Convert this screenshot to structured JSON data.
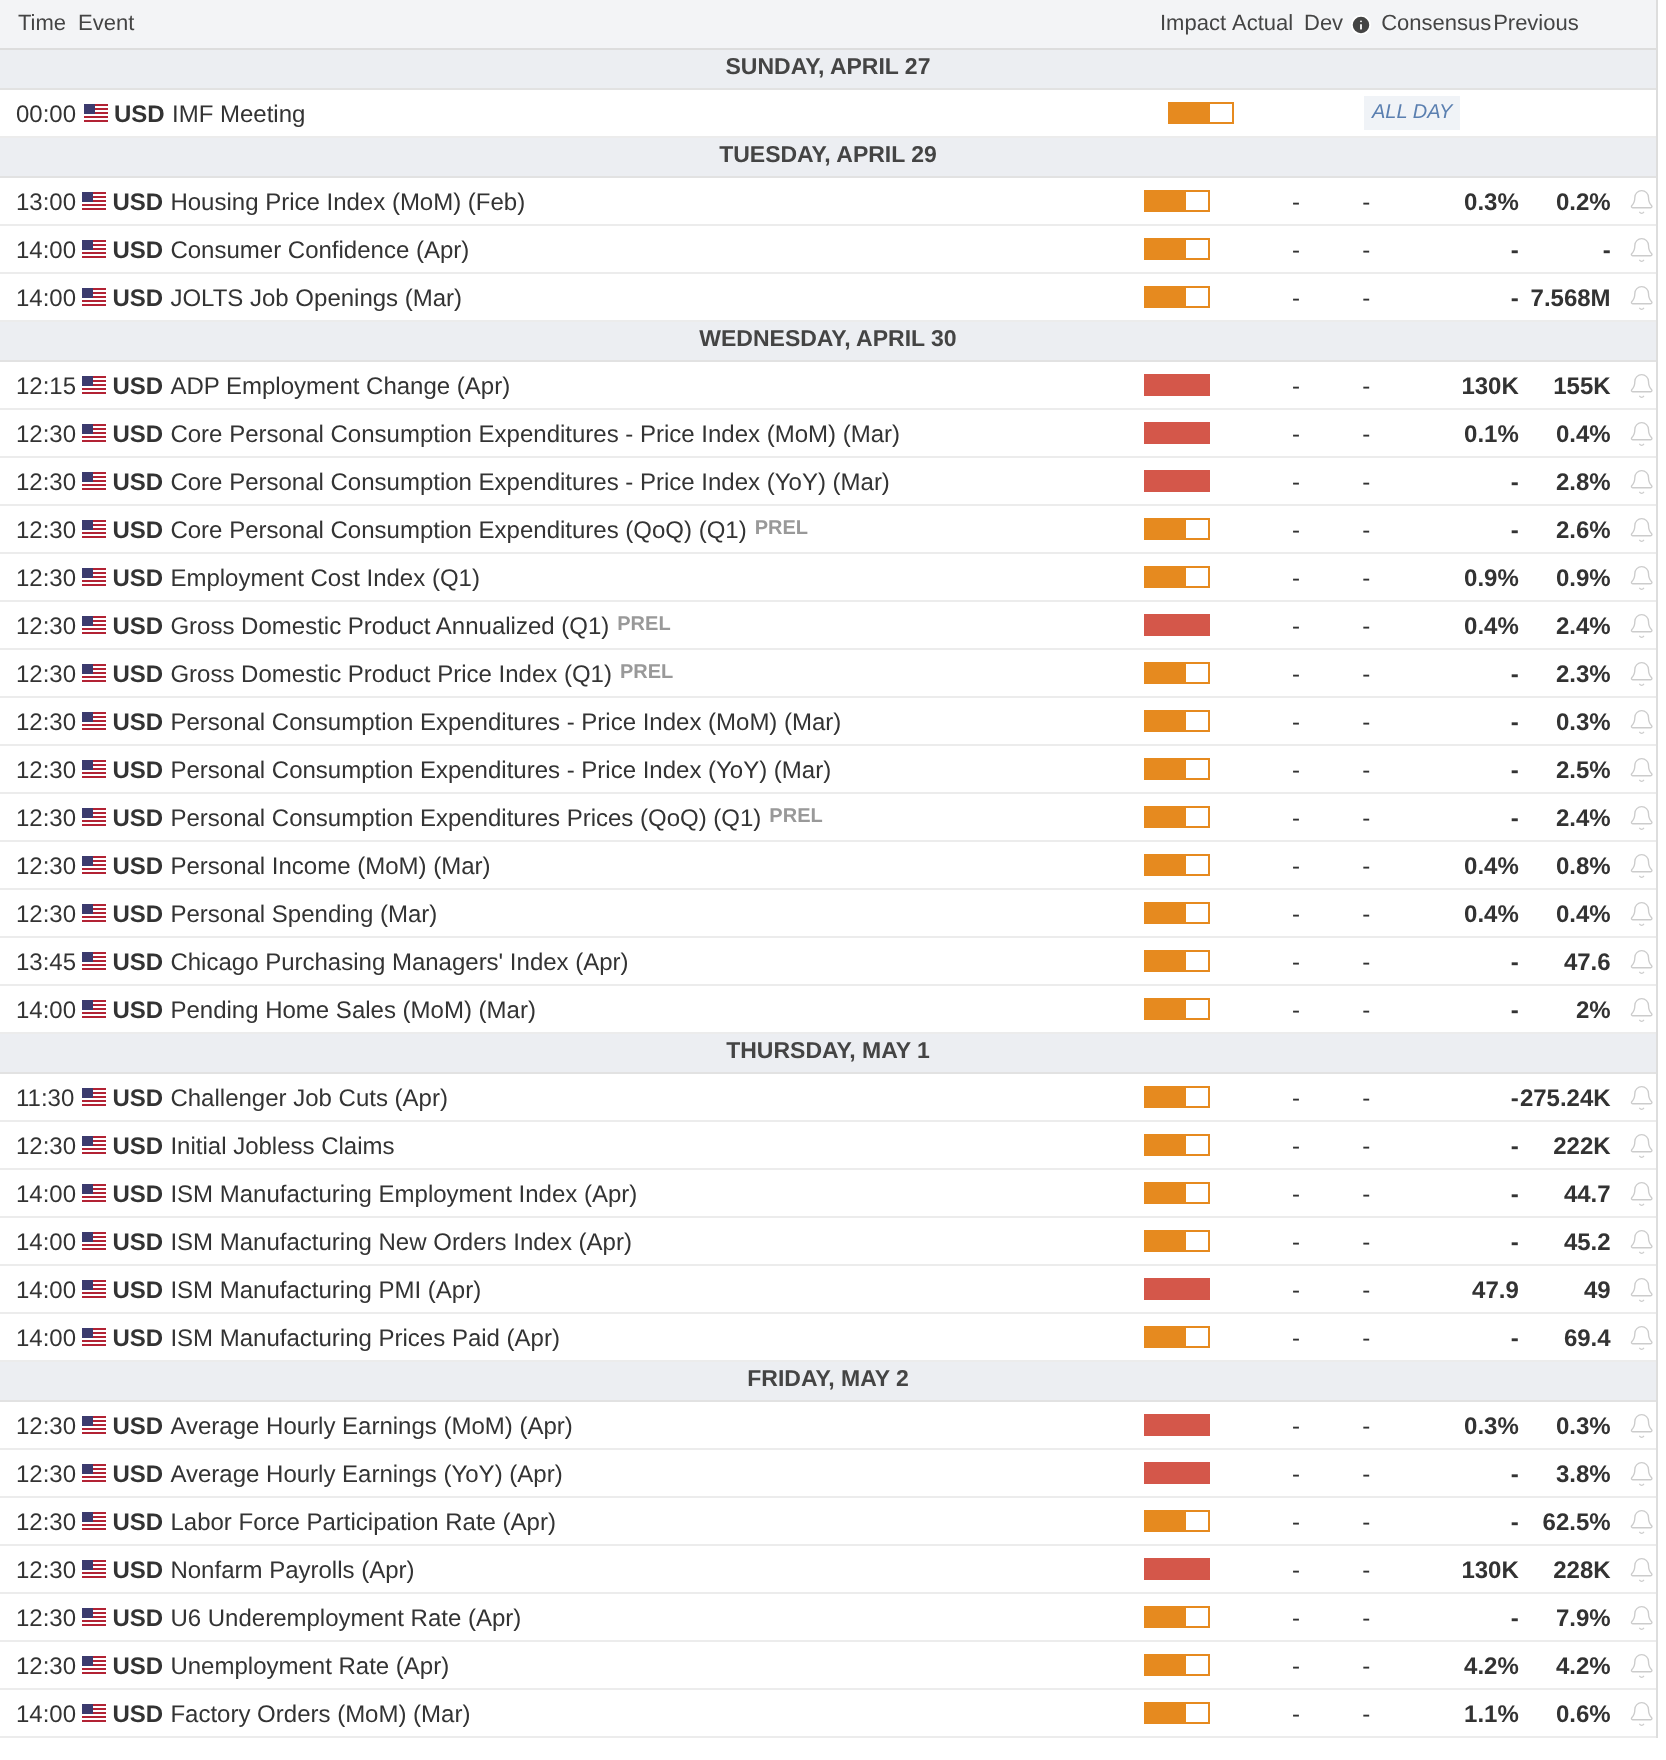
{
  "columns": {
    "time": "Time",
    "event": "Event",
    "impact": "Impact",
    "actual": "Actual",
    "dev": "Dev",
    "consensus": "Consensus",
    "previous": "Previous"
  },
  "days": [
    {
      "title": "SUNDAY, APRIL 27",
      "events": [
        {
          "time": "00:00",
          "currency": "USD",
          "name": "IMF Meeting",
          "kind": "medium",
          "all_day": "ALL DAY"
        }
      ]
    },
    {
      "title": "TUESDAY, APRIL 29",
      "events": [
        {
          "time": "13:00",
          "currency": "USD",
          "name": "Housing Price Index (MoM) (Feb)",
          "kind": "medium",
          "actual": "-",
          "dev": "-",
          "consensus": "0.3%",
          "previous": "0.2%"
        },
        {
          "time": "14:00",
          "currency": "USD",
          "name": "Consumer Confidence (Apr)",
          "kind": "medium",
          "actual": "-",
          "dev": "-",
          "consensus": "-",
          "previous": "-"
        },
        {
          "time": "14:00",
          "currency": "USD",
          "name": "JOLTS Job Openings (Mar)",
          "kind": "medium",
          "actual": "-",
          "dev": "-",
          "consensus": "-",
          "previous": "7.568M"
        }
      ]
    },
    {
      "title": "WEDNESDAY, APRIL 30",
      "events": [
        {
          "time": "12:15",
          "currency": "USD",
          "name": "ADP Employment Change (Apr)",
          "kind": "high",
          "actual": "-",
          "dev": "-",
          "consensus": "130K",
          "previous": "155K"
        },
        {
          "time": "12:30",
          "currency": "USD",
          "name": "Core Personal Consumption Expenditures - Price Index (MoM) (Mar)",
          "kind": "high",
          "actual": "-",
          "dev": "-",
          "consensus": "0.1%",
          "previous": "0.4%"
        },
        {
          "time": "12:30",
          "currency": "USD",
          "name": "Core Personal Consumption Expenditures - Price Index (YoY) (Mar)",
          "kind": "high",
          "actual": "-",
          "dev": "-",
          "consensus": "-",
          "previous": "2.8%"
        },
        {
          "time": "12:30",
          "currency": "USD",
          "name": "Core Personal Consumption Expenditures (QoQ) (Q1)",
          "tag": "PREL",
          "kind": "medium",
          "actual": "-",
          "dev": "-",
          "consensus": "-",
          "previous": "2.6%"
        },
        {
          "time": "12:30",
          "currency": "USD",
          "name": "Employment Cost Index (Q1)",
          "kind": "medium",
          "actual": "-",
          "dev": "-",
          "consensus": "0.9%",
          "previous": "0.9%"
        },
        {
          "time": "12:30",
          "currency": "USD",
          "name": "Gross Domestic Product Annualized (Q1)",
          "tag": "PREL",
          "kind": "high",
          "actual": "-",
          "dev": "-",
          "consensus": "0.4%",
          "previous": "2.4%"
        },
        {
          "time": "12:30",
          "currency": "USD",
          "name": "Gross Domestic Product Price Index (Q1)",
          "tag": "PREL",
          "kind": "medium",
          "actual": "-",
          "dev": "-",
          "consensus": "-",
          "previous": "2.3%"
        },
        {
          "time": "12:30",
          "currency": "USD",
          "name": "Personal Consumption Expenditures - Price Index (MoM) (Mar)",
          "kind": "medium",
          "actual": "-",
          "dev": "-",
          "consensus": "-",
          "previous": "0.3%"
        },
        {
          "time": "12:30",
          "currency": "USD",
          "name": "Personal Consumption Expenditures - Price Index (YoY) (Mar)",
          "kind": "medium",
          "actual": "-",
          "dev": "-",
          "consensus": "-",
          "previous": "2.5%"
        },
        {
          "time": "12:30",
          "currency": "USD",
          "name": "Personal Consumption Expenditures Prices (QoQ) (Q1)",
          "tag": "PREL",
          "kind": "medium",
          "actual": "-",
          "dev": "-",
          "consensus": "-",
          "previous": "2.4%"
        },
        {
          "time": "12:30",
          "currency": "USD",
          "name": "Personal Income (MoM) (Mar)",
          "kind": "medium",
          "actual": "-",
          "dev": "-",
          "consensus": "0.4%",
          "previous": "0.8%"
        },
        {
          "time": "12:30",
          "currency": "USD",
          "name": "Personal Spending (Mar)",
          "kind": "medium",
          "actual": "-",
          "dev": "-",
          "consensus": "0.4%",
          "previous": "0.4%"
        },
        {
          "time": "13:45",
          "currency": "USD",
          "name": "Chicago Purchasing Managers' Index (Apr)",
          "kind": "medium",
          "actual": "-",
          "dev": "-",
          "consensus": "-",
          "previous": "47.6"
        },
        {
          "time": "14:00",
          "currency": "USD",
          "name": "Pending Home Sales (MoM) (Mar)",
          "kind": "medium",
          "actual": "-",
          "dev": "-",
          "consensus": "-",
          "previous": "2%"
        }
      ]
    },
    {
      "title": "THURSDAY, MAY 1",
      "events": [
        {
          "time": "11:30",
          "currency": "USD",
          "name": "Challenger Job Cuts (Apr)",
          "kind": "medium",
          "actual": "-",
          "dev": "-",
          "consensus": "-",
          "previous": "275.24K"
        },
        {
          "time": "12:30",
          "currency": "USD",
          "name": "Initial Jobless Claims",
          "kind": "medium",
          "actual": "-",
          "dev": "-",
          "consensus": "-",
          "previous": "222K"
        },
        {
          "time": "14:00",
          "currency": "USD",
          "name": "ISM Manufacturing Employment Index (Apr)",
          "kind": "medium",
          "actual": "-",
          "dev": "-",
          "consensus": "-",
          "previous": "44.7"
        },
        {
          "time": "14:00",
          "currency": "USD",
          "name": "ISM Manufacturing New Orders Index (Apr)",
          "kind": "medium",
          "actual": "-",
          "dev": "-",
          "consensus": "-",
          "previous": "45.2"
        },
        {
          "time": "14:00",
          "currency": "USD",
          "name": "ISM Manufacturing PMI (Apr)",
          "kind": "high",
          "actual": "-",
          "dev": "-",
          "consensus": "47.9",
          "previous": "49"
        },
        {
          "time": "14:00",
          "currency": "USD",
          "name": "ISM Manufacturing Prices Paid (Apr)",
          "kind": "medium",
          "actual": "-",
          "dev": "-",
          "consensus": "-",
          "previous": "69.4"
        }
      ]
    },
    {
      "title": "FRIDAY, MAY 2",
      "events": [
        {
          "time": "12:30",
          "currency": "USD",
          "name": "Average Hourly Earnings (MoM) (Apr)",
          "kind": "high",
          "actual": "-",
          "dev": "-",
          "consensus": "0.3%",
          "previous": "0.3%"
        },
        {
          "time": "12:30",
          "currency": "USD",
          "name": "Average Hourly Earnings (YoY) (Apr)",
          "kind": "high",
          "actual": "-",
          "dev": "-",
          "consensus": "-",
          "previous": "3.8%"
        },
        {
          "time": "12:30",
          "currency": "USD",
          "name": "Labor Force Participation Rate (Apr)",
          "kind": "medium",
          "actual": "-",
          "dev": "-",
          "consensus": "-",
          "previous": "62.5%"
        },
        {
          "time": "12:30",
          "currency": "USD",
          "name": "Nonfarm Payrolls (Apr)",
          "kind": "high",
          "actual": "-",
          "dev": "-",
          "consensus": "130K",
          "previous": "228K"
        },
        {
          "time": "12:30",
          "currency": "USD",
          "name": "U6 Underemployment Rate (Apr)",
          "kind": "medium",
          "actual": "-",
          "dev": "-",
          "consensus": "-",
          "previous": "7.9%"
        },
        {
          "time": "12:30",
          "currency": "USD",
          "name": "Unemployment Rate (Apr)",
          "kind": "medium",
          "actual": "-",
          "dev": "-",
          "consensus": "4.2%",
          "previous": "4.2%"
        },
        {
          "time": "14:00",
          "currency": "USD",
          "name": "Factory Orders (MoM) (Mar)",
          "kind": "medium",
          "actual": "-",
          "dev": "-",
          "consensus": "1.1%",
          "previous": "0.6%"
        }
      ]
    }
  ]
}
